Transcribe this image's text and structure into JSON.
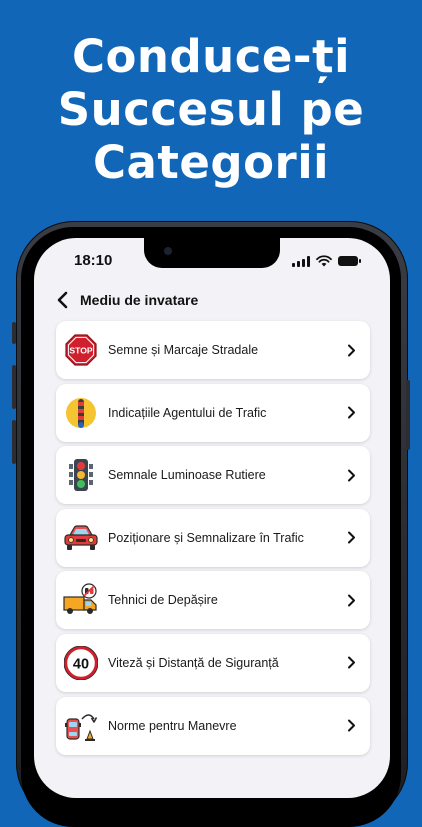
{
  "headline": {
    "line1": "Conduce-ți",
    "line2": "Succesul pe",
    "line3": "Categorii"
  },
  "status_bar": {
    "time": "18:10"
  },
  "nav": {
    "back_icon": "chevron-left-icon",
    "title": "Mediu de invatare"
  },
  "categories": [
    {
      "label": "Semne și Marcaje Stradale",
      "icon": "stop-sign-icon",
      "icon_text": "STOP"
    },
    {
      "label": "Indicațiile Agentului de Trafic",
      "icon": "traffic-officer-icon"
    },
    {
      "label": "Semnale Luminoase Rutiere",
      "icon": "traffic-light-icon"
    },
    {
      "label": "Poziționare și Semnalizare în Trafic",
      "icon": "car-icon"
    },
    {
      "label": "Tehnici de Depășire",
      "icon": "overtaking-truck-icon"
    },
    {
      "label": "Viteză și Distanță de Siguranță",
      "icon": "speed-limit-icon",
      "icon_text": "40"
    },
    {
      "label": "Norme pentru Manevre",
      "icon": "maneuver-car-icon"
    }
  ],
  "colors": {
    "background": "#1266b8",
    "screen": "#f2f2f7",
    "card": "#ffffff",
    "stop_red": "#d0202e",
    "speed_ring": "#d0202e"
  }
}
